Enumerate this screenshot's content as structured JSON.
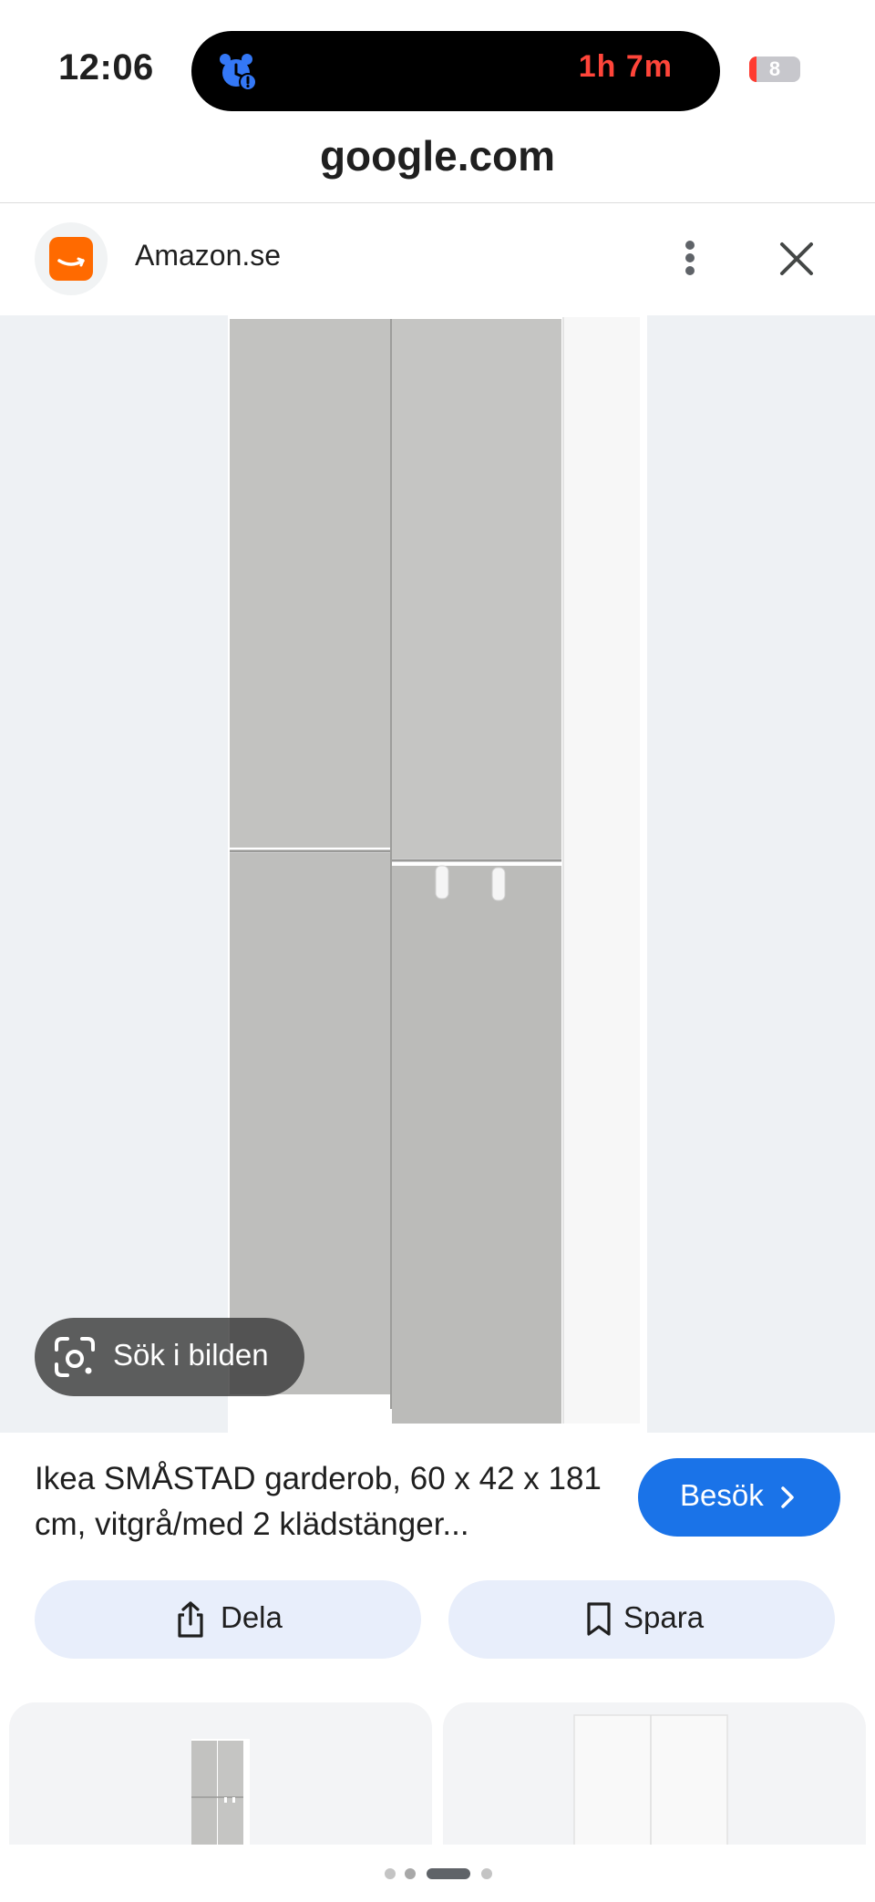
{
  "status_bar": {
    "time": "12:06",
    "timer": "1h 7m",
    "battery": "8",
    "alarm_icon": "alarm-icon"
  },
  "browser": {
    "url": "google.com"
  },
  "source": {
    "name": "Amazon.se",
    "logo_icon": "amazon-logo-icon",
    "more_icon": "more-vert-icon",
    "close_icon": "close-icon"
  },
  "image": {
    "description_icon": "wardrobe-image",
    "lens_label": "Sök i bilden"
  },
  "product": {
    "title": "Ikea SMÅSTAD garderob, 60 x 42 x 181 cm, vitgrå/med 2 klädstänger...",
    "visit_label": "Besök"
  },
  "actions": {
    "share_label": "Dela",
    "save_label": "Spara"
  },
  "pager": {
    "pages": 4,
    "active": 2
  },
  "colors": {
    "accent": "#1a73e8",
    "amazon": "#ff6a00",
    "timer": "#ff453a",
    "action_bg": "#e8eefb"
  }
}
